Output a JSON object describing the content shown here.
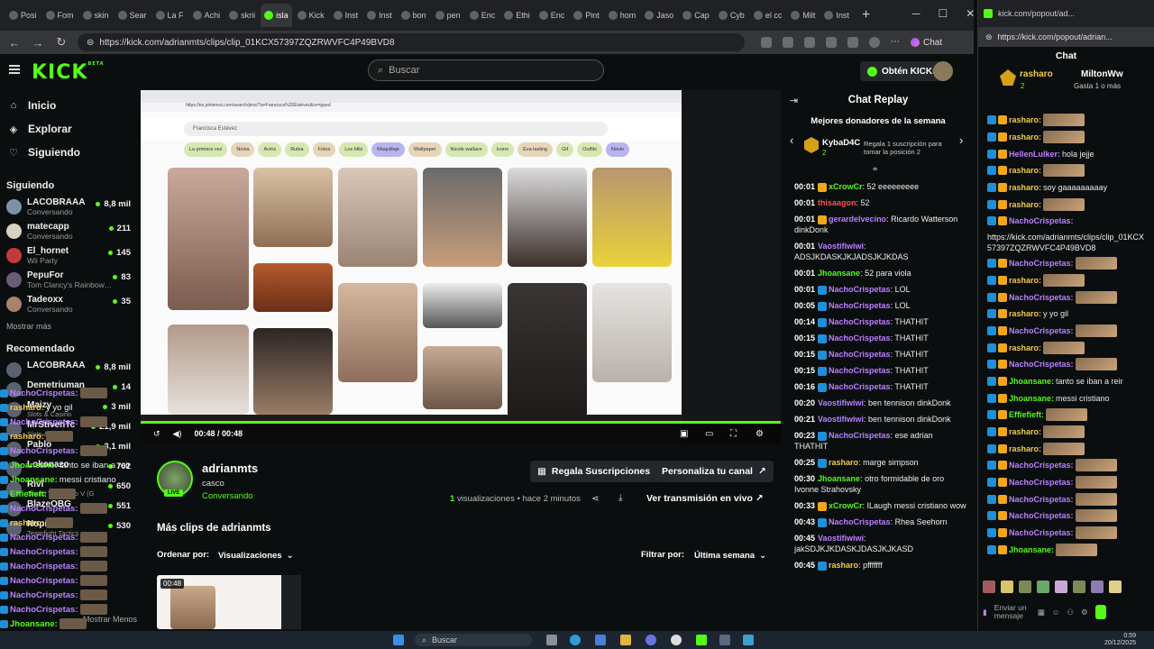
{
  "browser": {
    "tabs": [
      "Posi",
      "Fom",
      "skin",
      "Sear",
      "La F",
      "Achi",
      "skrii",
      "isla",
      "Kick",
      "Inst",
      "Inst",
      "bon",
      "pen",
      "Enc",
      "Ethi",
      "Enc",
      "Pint",
      "hom",
      "Jaso",
      "Cap",
      "Cyb",
      "el cc",
      "Milt",
      "Inst"
    ],
    "new_tab": "+",
    "url": "https://kick.com/adrianmts/clips/clip_01KCX57397ZQZRWVFC4P49BVD8",
    "chat_button": "Chat"
  },
  "kick": {
    "logo": "KICK",
    "logo_badge": "BETA",
    "search_placeholder": "Buscar",
    "get_kicks": "Obtén KICKs"
  },
  "sidebar": {
    "nav": [
      {
        "label": "Inicio",
        "icon": "home-icon"
      },
      {
        "label": "Explorar",
        "icon": "compass-icon"
      },
      {
        "label": "Siguiendo",
        "icon": "heart-icon"
      }
    ],
    "following_title": "Siguiendo",
    "following": [
      {
        "name": "LACOBRAAA",
        "category": "Conversando",
        "viewers": "8,8 mil",
        "color": "#7e8fa8"
      },
      {
        "name": "matecapp",
        "category": "Conversando",
        "viewers": "211",
        "color": "#d9d2c0"
      },
      {
        "name": "El_hornet",
        "category": "Wii Party",
        "viewers": "145",
        "color": "#c43a3a"
      },
      {
        "name": "PepuFor",
        "category": "Tom Clancy's Rainbow ...",
        "viewers": "83",
        "color": "#6a5b7b"
      },
      {
        "name": "Tadeoxx",
        "category": "Conversando",
        "viewers": "35",
        "color": "#a8836b"
      }
    ],
    "show_more": "Mostrar más",
    "recommended_title": "Recomendado",
    "recommended": [
      {
        "name": "LACOBRAAA",
        "viewers": "8,8 mil"
      },
      {
        "name": "Demetriuman",
        "viewers": "14"
      },
      {
        "name": "Maizy",
        "category": "Slots & Casino",
        "viewers": "3 mil"
      },
      {
        "name": "MrStivenTc",
        "category": "Slots & Casino",
        "viewers": "21,9 mil"
      },
      {
        "name": "Pablo",
        "viewers": "3,1 mil"
      },
      {
        "name": "Lokonazo",
        "viewers": "702"
      },
      {
        "name": "Rivi",
        "category": "Grand Theft Auto V (G",
        "viewers": "650"
      },
      {
        "name": "BlazeOBG",
        "viewers": "551"
      },
      {
        "name": "Nopi",
        "category": "Teamfight Tactics",
        "viewers": "530"
      }
    ],
    "show_less": "Mostrar Menos"
  },
  "overlay_chat": [
    {
      "user": "NachoCrispetas:",
      "text": "",
      "color": "#b980ff"
    },
    {
      "user": "rasharo:",
      "text": "y yo gil",
      "color": "#f2c94c"
    },
    {
      "user": "NachoCrispetas:",
      "text": "",
      "color": "#b980ff"
    },
    {
      "user": "rasharo:",
      "text": "",
      "color": "#f2c94c"
    },
    {
      "user": "NachoCrispetas:",
      "text": "",
      "color": "#b980ff"
    },
    {
      "user": "Jhoansane:",
      "text": "tanto se iban a reir",
      "color": "#53fc18"
    },
    {
      "user": "Jhoansane:",
      "text": "messi cristiano",
      "color": "#53fc18"
    },
    {
      "user": "Effiefieft:",
      "text": "",
      "color": "#53fc18"
    },
    {
      "user": "NachoCrispetas:",
      "text": "",
      "color": "#b980ff"
    },
    {
      "user": "rasharo:",
      "text": "",
      "color": "#f2c94c"
    },
    {
      "user": "NachoCrispetas:",
      "text": "",
      "color": "#b980ff"
    },
    {
      "user": "NachoCrispetas:",
      "text": "",
      "color": "#b980ff"
    },
    {
      "user": "NachoCrispetas:",
      "text": "",
      "color": "#b980ff"
    },
    {
      "user": "NachoCrispetas:",
      "text": "",
      "color": "#b980ff"
    },
    {
      "user": "NachoCrispetas:",
      "text": "",
      "color": "#b980ff"
    },
    {
      "user": "NachoCrispetas:",
      "text": "",
      "color": "#b980ff"
    },
    {
      "user": "Jhoansane:",
      "text": "",
      "color": "#53fc18"
    }
  ],
  "video": {
    "pinterest_search": "Francisca Estévez",
    "chips": [
      "La primera vez",
      "Novia",
      "Actriz",
      "Rubia",
      "Fotos",
      "Los bilis",
      "Maquillaje",
      "Wallpaper",
      "Nicole wallace",
      "Icono",
      "Eva lasting",
      "Gif",
      "Outfits",
      "Novio"
    ],
    "time": "00:48 / 00:48",
    "progress": 1.0
  },
  "clip": {
    "streamer": "adrianmts",
    "title": "casco",
    "category": "Conversando",
    "live_badge": "LIVE",
    "views_count": "1",
    "views_label": "visualizaciones",
    "ago": "hace 2 minutos",
    "gift_subs": "Regala Suscripciones",
    "customize": "Personaliza tu canal",
    "watch_live": "Ver transmisión en vivo",
    "more_clips": "Más clips de adrianmts",
    "sort_label": "Ordenar por:",
    "sort_value": "Visualizaciones",
    "filter_label": "Filtrar por:",
    "filter_value": "Última semana",
    "thumb_duration": "00:48"
  },
  "replay": {
    "title": "Chat Replay",
    "donors_title": "Mejores donadores de la semana",
    "donor_name": "KybaD4C",
    "donor_count": "2",
    "gift_text": "Regala 1 suscripción para tomar la posición 2",
    "messages": [
      {
        "ts": "00:01",
        "user": "xCrowCr",
        "text": ": 52 eeeeeeeee",
        "color": "#53fc18",
        "badge": "#f2a71a"
      },
      {
        "ts": "00:01",
        "user": "thisaagon",
        "text": ": 52",
        "color": "#ff4d4d",
        "badge": ""
      },
      {
        "ts": "00:01",
        "user": "gerardelvecino",
        "text": ": Ricardo Watterson dinkDonk",
        "color": "#b980ff",
        "badge": "#f2a71a"
      },
      {
        "ts": "00:01",
        "user": "Vaostifiwiwi",
        "text": ": ADSJKDASKJKJADSJKJKDAS",
        "color": "#b980ff",
        "badge": ""
      },
      {
        "ts": "00:01",
        "user": "Jhoansane",
        "text": ": 52 para viola",
        "color": "#53fc18",
        "badge": ""
      },
      {
        "ts": "00:01",
        "user": "NachoCrispetas",
        "text": ": LOL",
        "color": "#b980ff",
        "badge": "#1e8fd8"
      },
      {
        "ts": "00:05",
        "user": "NachoCrispetas",
        "text": ": LOL",
        "color": "#b980ff",
        "badge": "#1e8fd8"
      },
      {
        "ts": "00:14",
        "user": "NachoCrispetas",
        "text": ": THATHIT",
        "color": "#b980ff",
        "badge": "#1e8fd8"
      },
      {
        "ts": "00:15",
        "user": "NachoCrispetas",
        "text": ": THATHIT",
        "color": "#b980ff",
        "badge": "#1e8fd8"
      },
      {
        "ts": "00:15",
        "user": "NachoCrispetas",
        "text": ": THATHIT",
        "color": "#b980ff",
        "badge": "#1e8fd8"
      },
      {
        "ts": "00:15",
        "user": "NachoCrispetas",
        "text": ": THATHIT",
        "color": "#b980ff",
        "badge": "#1e8fd8"
      },
      {
        "ts": "00:16",
        "user": "NachoCrispetas",
        "text": ": THATHIT",
        "color": "#b980ff",
        "badge": "#1e8fd8"
      },
      {
        "ts": "00:20",
        "user": "Vaostifiwiwi",
        "text": ": ben tennison dinkDonk",
        "color": "#b980ff",
        "badge": ""
      },
      {
        "ts": "00:21",
        "user": "Vaostifiwiwi",
        "text": ": ben tennison dinkDonk",
        "color": "#b980ff",
        "badge": ""
      },
      {
        "ts": "00:23",
        "user": "NachoCrispetas",
        "text": ": ese adrian THATHIT",
        "color": "#b980ff",
        "badge": "#1e8fd8"
      },
      {
        "ts": "00:25",
        "user": "rasharo",
        "text": ": marge simpson",
        "color": "#f2c94c",
        "badge": "#1e8fd8"
      },
      {
        "ts": "00:30",
        "user": "Jhoansane",
        "text": ": otro formidable de oro Ivonne Strahovsky",
        "color": "#53fc18",
        "badge": ""
      },
      {
        "ts": "00:33",
        "user": "xCrowCr",
        "text": ": ILaugh messi cristiano wow",
        "color": "#53fc18",
        "badge": "#f2a71a"
      },
      {
        "ts": "00:43",
        "user": "NachoCrispetas",
        "text": ": Rhea Seehorn",
        "color": "#b980ff",
        "badge": "#1e8fd8"
      },
      {
        "ts": "00:45",
        "user": "Vaostifiwiwi",
        "text": ": jakSDJKJKDASKJDASJKJKASD",
        "color": "#b980ff",
        "badge": ""
      },
      {
        "ts": "00:45",
        "user": "rasharo",
        "text": ": pfffffff",
        "color": "#f2c94c",
        "badge": "#1e8fd8"
      }
    ]
  },
  "popout": {
    "tab_title": "kick.com/popout/ad...",
    "url": "https://kick.com/popout/adrian...",
    "chat_title": "Chat",
    "pinned_name1": "rasharo",
    "pinned_name2": "MiltonWw",
    "pinned_count1": "2",
    "pinned_gift": "Gasta 1 o más",
    "messages": [
      {
        "user": "rasharo:",
        "text": "",
        "color": "#f2c94c",
        "emote": true
      },
      {
        "user": "rasharo:",
        "text": "",
        "color": "#f2c94c",
        "emote": true
      },
      {
        "user": "HellenLulker:",
        "text": "hola jejje",
        "color": "#b980ff",
        "emote": false
      },
      {
        "user": "rasharo:",
        "text": "",
        "color": "#f2c94c",
        "emote": true
      },
      {
        "user": "rasharo:",
        "text": "soy gaaaaaaaaay",
        "color": "#f2c94c",
        "emote": false
      },
      {
        "user": "rasharo:",
        "text": "",
        "color": "#f2c94c",
        "emote": true
      },
      {
        "user": "NachoCrispetas:",
        "text": "",
        "color": "#b980ff",
        "emote": false
      },
      {
        "user": "NachoCrispetas:",
        "text": "",
        "color": "#b980ff",
        "emote": true
      },
      {
        "user": "rasharo:",
        "text": "",
        "color": "#f2c94c",
        "emote": true
      },
      {
        "user": "NachoCrispetas:",
        "text": "",
        "color": "#b980ff",
        "emote": true
      },
      {
        "user": "rasharo:",
        "text": "y yo gil",
        "color": "#f2c94c",
        "emote": false
      },
      {
        "user": "NachoCrispetas:",
        "text": "",
        "color": "#b980ff",
        "emote": true
      },
      {
        "user": "rasharo:",
        "text": "",
        "color": "#f2c94c",
        "emote": true
      },
      {
        "user": "NachoCrispetas:",
        "text": "",
        "color": "#b980ff",
        "emote": true
      },
      {
        "user": "Jhoansane:",
        "text": "tanto se iban a reir",
        "color": "#53fc18",
        "emote": false
      },
      {
        "user": "Jhoansane:",
        "text": "messi cristiano",
        "color": "#53fc18",
        "emote": false
      },
      {
        "user": "Effiefieft:",
        "text": "",
        "color": "#53fc18",
        "emote": true
      },
      {
        "user": "rasharo:",
        "text": "",
        "color": "#f2c94c",
        "emote": true
      },
      {
        "user": "rasharo:",
        "text": "",
        "color": "#f2c94c",
        "emote": true
      },
      {
        "user": "NachoCrispetas:",
        "text": "",
        "color": "#b980ff",
        "emote": true
      },
      {
        "user": "NachoCrispetas:",
        "text": "",
        "color": "#b980ff",
        "emote": true
      },
      {
        "user": "NachoCrispetas:",
        "text": "",
        "color": "#b980ff",
        "emote": true
      },
      {
        "user": "NachoCrispetas:",
        "text": "",
        "color": "#b980ff",
        "emote": true
      },
      {
        "user": "NachoCrispetas:",
        "text": "",
        "color": "#b980ff",
        "emote": true
      },
      {
        "user": "Jhoansane:",
        "text": "",
        "color": "#53fc18",
        "emote": true
      }
    ],
    "link_text": "https://kick.com/adrianmts/clips/clip_01KCX57397ZQZRWVFC4P49BVD8",
    "input_placeholder": "Enviar un mensaje"
  },
  "taskbar": {
    "search": "Buscar",
    "time": "0:59",
    "date": "20/12/2025"
  },
  "colors": {
    "kick_green": "#53fc18",
    "background": "#0b0e0f",
    "panel": "#24272c"
  }
}
